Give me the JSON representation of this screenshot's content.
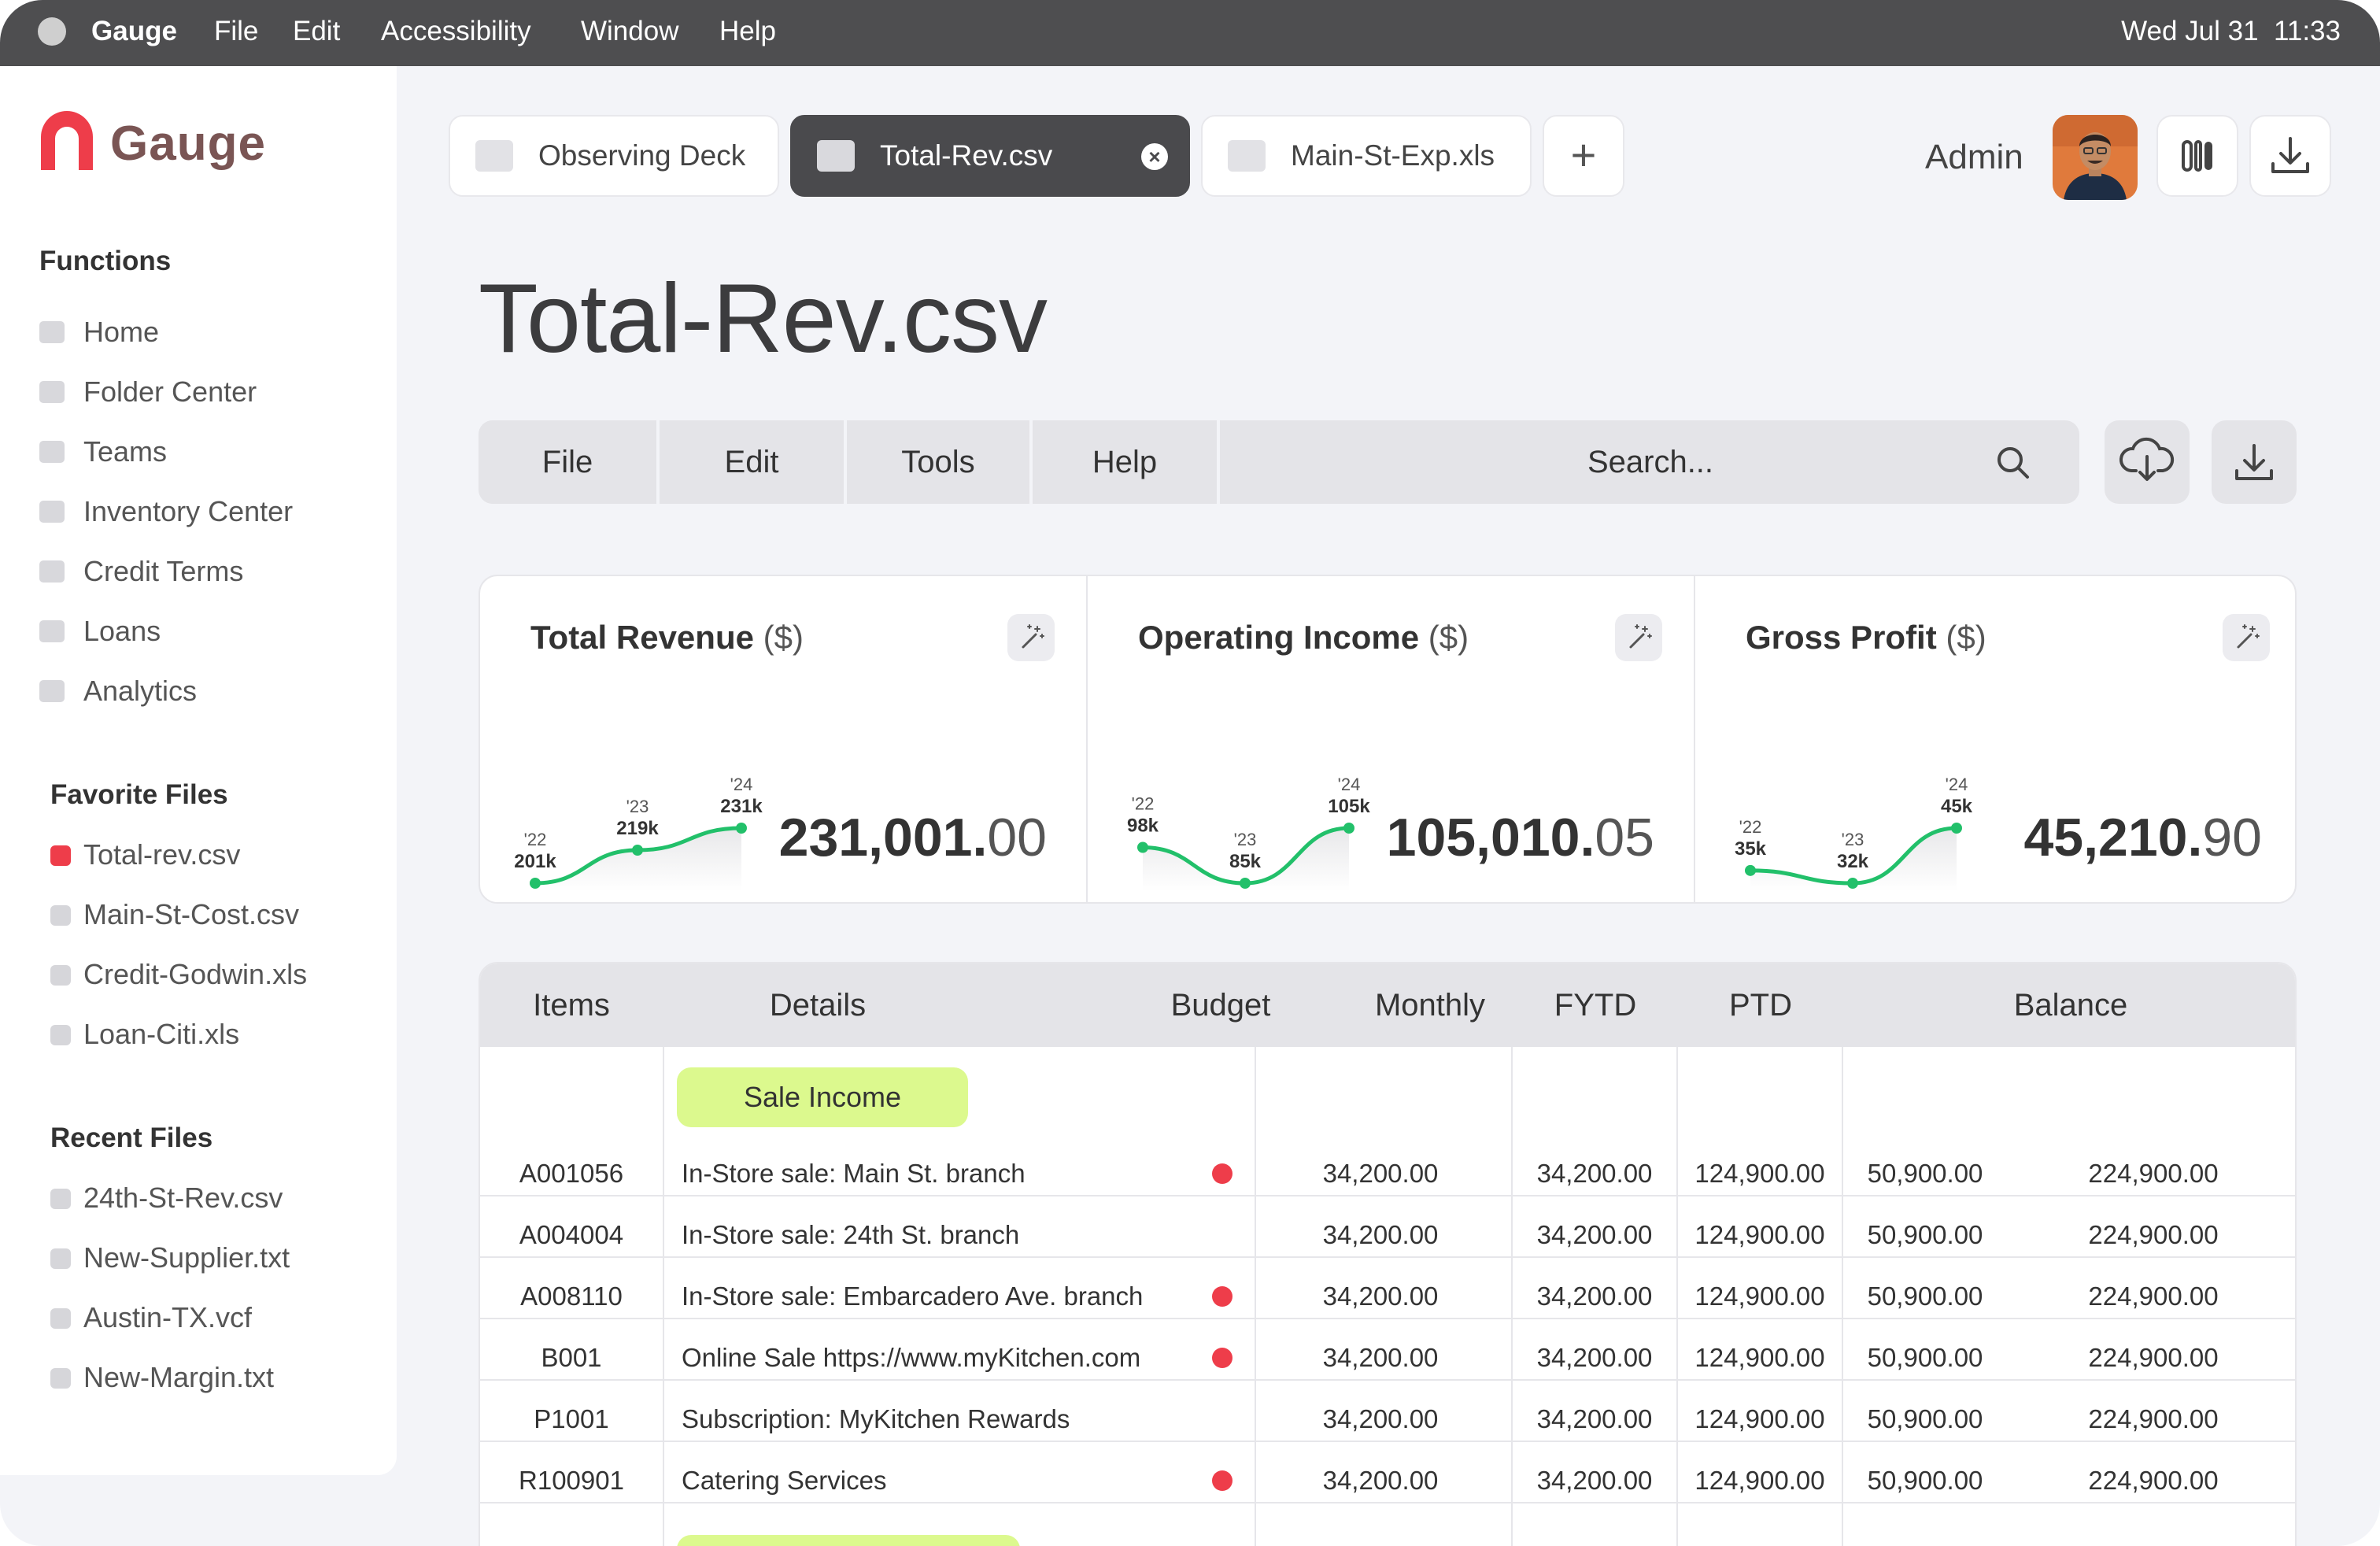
{
  "menubar": {
    "app": "Gauge",
    "items": [
      "File",
      "Edit",
      "Accessibility",
      "Window",
      "Help"
    ],
    "date": "Wed Jul 31",
    "time": "11:33"
  },
  "sidebar": {
    "logo": "Gauge",
    "functions_title": "Functions",
    "functions": [
      "Home",
      "Folder Center",
      "Teams",
      "Inventory Center",
      "Credit Terms",
      "Loans",
      "Analytics"
    ],
    "favorites_title": "Favorite Files",
    "favorites": [
      "Total-rev.csv",
      "Main-St-Cost.csv",
      "Credit-Godwin.xls",
      "Loan-Citi.xls"
    ],
    "recent_title": "Recent Files",
    "recent": [
      "24th-St-Rev.csv",
      "New-Supplier.txt",
      "Austin-TX.vcf",
      "New-Margin.txt"
    ]
  },
  "tabs": [
    {
      "label": "Observing Deck",
      "active": false
    },
    {
      "label": "Total-Rev.csv",
      "active": true
    },
    {
      "label": "Main-St-Exp.xls",
      "active": false
    }
  ],
  "header": {
    "user": "Admin"
  },
  "page_title": "Total-Rev.csv",
  "toolbar": {
    "menus": [
      "File",
      "Edit",
      "Tools",
      "Help"
    ],
    "search_placeholder": "Search..."
  },
  "cards": [
    {
      "title": "Total Revenue",
      "unit": "($)",
      "value_int": "231,001.",
      "value_dec": "00",
      "points": [
        {
          "year": "'22",
          "label": "201k",
          "value": 201
        },
        {
          "year": "'23",
          "label": "219k",
          "value": 219
        },
        {
          "year": "'24",
          "label": "231k",
          "value": 231
        }
      ]
    },
    {
      "title": "Operating Income",
      "unit": "($)",
      "value_int": "105,010.",
      "value_dec": "05",
      "points": [
        {
          "year": "'22",
          "label": "98k",
          "value": 98
        },
        {
          "year": "'23",
          "label": "85k",
          "value": 85
        },
        {
          "year": "'24",
          "label": "105k",
          "value": 105
        }
      ]
    },
    {
      "title": "Gross Profit",
      "unit": "($)",
      "value_int": "45,210.",
      "value_dec": "90",
      "points": [
        {
          "year": "'22",
          "label": "35k",
          "value": 35
        },
        {
          "year": "'23",
          "label": "32k",
          "value": 32
        },
        {
          "year": "'24",
          "label": "45k",
          "value": 45
        }
      ]
    }
  ],
  "table": {
    "columns": [
      "Items",
      "Details",
      "Budget",
      "Monthly",
      "FYTD",
      "PTD",
      "Balance"
    ],
    "group_label": "Sale Income",
    "rows": [
      {
        "item": "A001056",
        "detail": "In-Store sale: Main St. branch",
        "flag": true,
        "budget": "34,200.00",
        "monthly": "34,200.00",
        "fytd": "124,900.00",
        "ptd": "50,900.00",
        "balance": "224,900.00"
      },
      {
        "item": "A004004",
        "detail": "In-Store sale: 24th St. branch",
        "flag": false,
        "budget": "34,200.00",
        "monthly": "34,200.00",
        "fytd": "124,900.00",
        "ptd": "50,900.00",
        "balance": "224,900.00"
      },
      {
        "item": "A008110",
        "detail": "In-Store sale: Embarcadero Ave. branch",
        "flag": true,
        "budget": "34,200.00",
        "monthly": "34,200.00",
        "fytd": "124,900.00",
        "ptd": "50,900.00",
        "balance": "224,900.00"
      },
      {
        "item": "B001",
        "detail": "Online Sale https://www.myKitchen.com",
        "flag": true,
        "budget": "34,200.00",
        "monthly": "34,200.00",
        "fytd": "124,900.00",
        "ptd": "50,900.00",
        "balance": "224,900.00"
      },
      {
        "item": "P1001",
        "detail": "Subscription: MyKitchen Rewards",
        "flag": false,
        "budget": "34,200.00",
        "monthly": "34,200.00",
        "fytd": "124,900.00",
        "ptd": "50,900.00",
        "balance": "224,900.00"
      },
      {
        "item": "R100901",
        "detail": "Catering Services",
        "flag": true,
        "budget": "34,200.00",
        "monthly": "34,200.00",
        "fytd": "124,900.00",
        "ptd": "50,900.00",
        "balance": "224,900.00"
      }
    ]
  },
  "colors": {
    "accent_red": "#ee3d4a",
    "spark_green": "#22c06a",
    "pill_green": "#dcf98e",
    "dark_tab": "#4a4a4d"
  }
}
